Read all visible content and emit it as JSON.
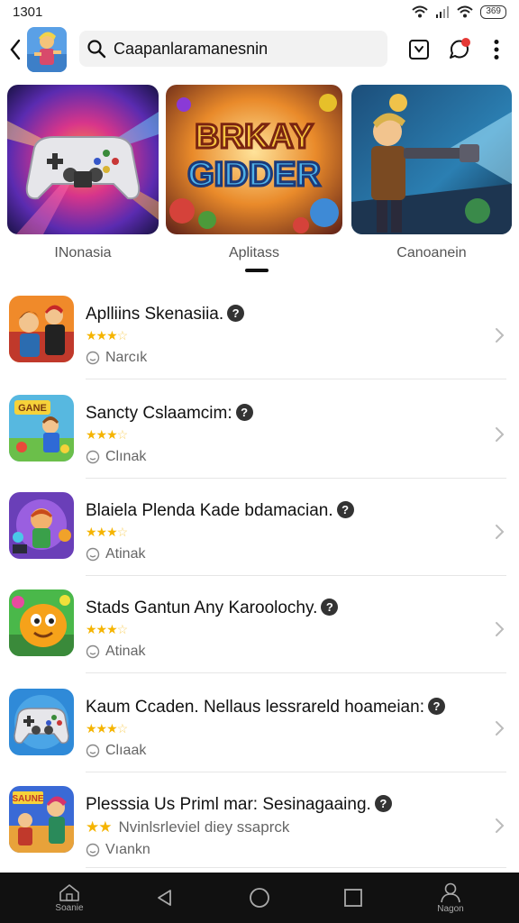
{
  "status": {
    "time": "1301",
    "battery": "369"
  },
  "header": {
    "search_value": "Caapanlaramanesnin"
  },
  "banners": [
    {
      "label": "INonasia"
    },
    {
      "label": "Aplitass",
      "art_text_1": "BRKAY",
      "art_text_2": "GIDDER"
    },
    {
      "label": "Canoanein"
    }
  ],
  "items": [
    {
      "title": "Aplliins Skenasiia.",
      "stars": "★★★",
      "half": "☆",
      "rating_note": "",
      "sub": "Narcık",
      "icon": "icon-fighter"
    },
    {
      "title": "Sancty Cslaamcim:",
      "stars": "★★★",
      "half": "☆",
      "rating_note": "",
      "sub": "Clınak",
      "icon": "icon-game",
      "icon_text": "GANE"
    },
    {
      "title": "Blaiela Plenda Kade bdamacian.",
      "stars": "★★★",
      "half": "☆",
      "rating_note": "",
      "sub": "Atinak",
      "icon": "icon-arcade"
    },
    {
      "title": "Stads Gantun Any Karoolochy.",
      "stars": "★★★",
      "half": "☆",
      "rating_note": "",
      "sub": "Atinak",
      "icon": "icon-slime"
    },
    {
      "title": "Kaum Ccaden. Nellaus lessrareld hoameian:",
      "stars": "★★★",
      "half": "☆",
      "rating_note": "",
      "sub": "Clıaak",
      "icon": "icon-controller"
    },
    {
      "title": "Plesssia Us Priml mar: Sesinagaaing.",
      "stars": "★★",
      "half": "",
      "rating_note": "Nvinlsrleviel diey ssaprck",
      "sub": "Vıankn",
      "icon": "icon-heroes",
      "icon_text": "SAUNE"
    }
  ],
  "nav": {
    "home_label": "Soanie",
    "profile_label": "Nagon"
  },
  "colors": {
    "accent_red": "#e53935",
    "star": "#f5b400",
    "navbar": "#111111"
  }
}
